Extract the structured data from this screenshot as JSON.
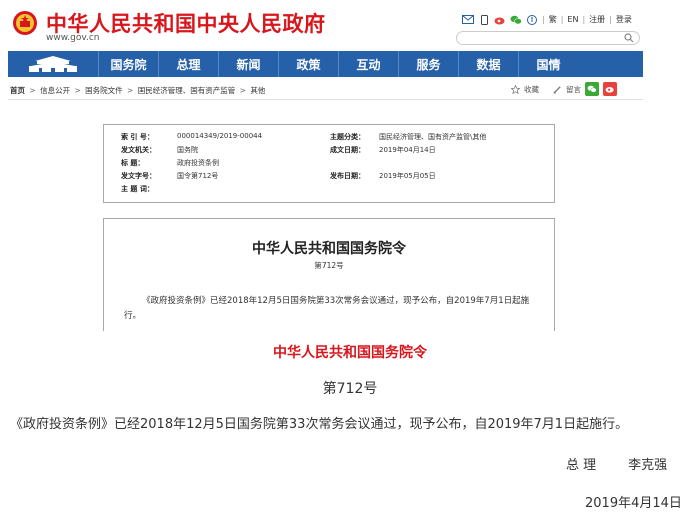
{
  "header": {
    "site_title": "中华人民共和国中央人民政府",
    "site_url": "www.gov.cn",
    "top_links": {
      "traditional": "繁",
      "english": "EN",
      "register": "注册",
      "login": "登录"
    },
    "search": {
      "placeholder": ""
    }
  },
  "nav": {
    "items": [
      {
        "label": "国务院"
      },
      {
        "label": "总理"
      },
      {
        "label": "新闻"
      },
      {
        "label": "政策"
      },
      {
        "label": "互动"
      },
      {
        "label": "服务"
      },
      {
        "label": "数据"
      },
      {
        "label": "国情"
      }
    ]
  },
  "breadcrumb": {
    "items": [
      "首页",
      "信息公开",
      "国务院文件",
      "国民经济管理、国有资产监管",
      "其他"
    ],
    "separator": ">"
  },
  "tools": {
    "favorite": "收藏",
    "comment": "留言"
  },
  "info": {
    "index_label": "索  引  号：",
    "index_value": "000014349/2019-00044",
    "category_label": "主题分类：",
    "category_value": "国民经济管理、国有资产监管\\其他",
    "issuer_label": "发文机关：",
    "issuer_value": "国务院",
    "created_label": "成文日期：",
    "created_value": "2019年04月14日",
    "title_label": "标    题：",
    "title_value": "政府投资条例",
    "docno_label": "发文字号：",
    "docno_value": "国令第712号",
    "published_label": "发布日期：",
    "published_value": "2019年05月05日",
    "keywords_label": "主  题  词："
  },
  "doc": {
    "title": "中华人民共和国国务院令",
    "number": "第712号",
    "body": "《政府投资条例》已经2018年12月5日国务院第33次常务会议通过，现予公布，自2019年7月1日起施行。"
  },
  "article": {
    "title": "中华人民共和国国务院令",
    "number": "第712号",
    "body": "《政府投资条例》已经2018年12月5日国务院第33次常务会议通过，现予公布，自2019年7月1日起施行。",
    "sign_title": "总  理",
    "sign_name": "李克强",
    "date": "2019年4月14日"
  },
  "colors": {
    "brand_red": "#d8161c",
    "nav_blue": "#2560a8",
    "wechat_green": "#3aa935",
    "weibo_red": "#e8423b"
  }
}
